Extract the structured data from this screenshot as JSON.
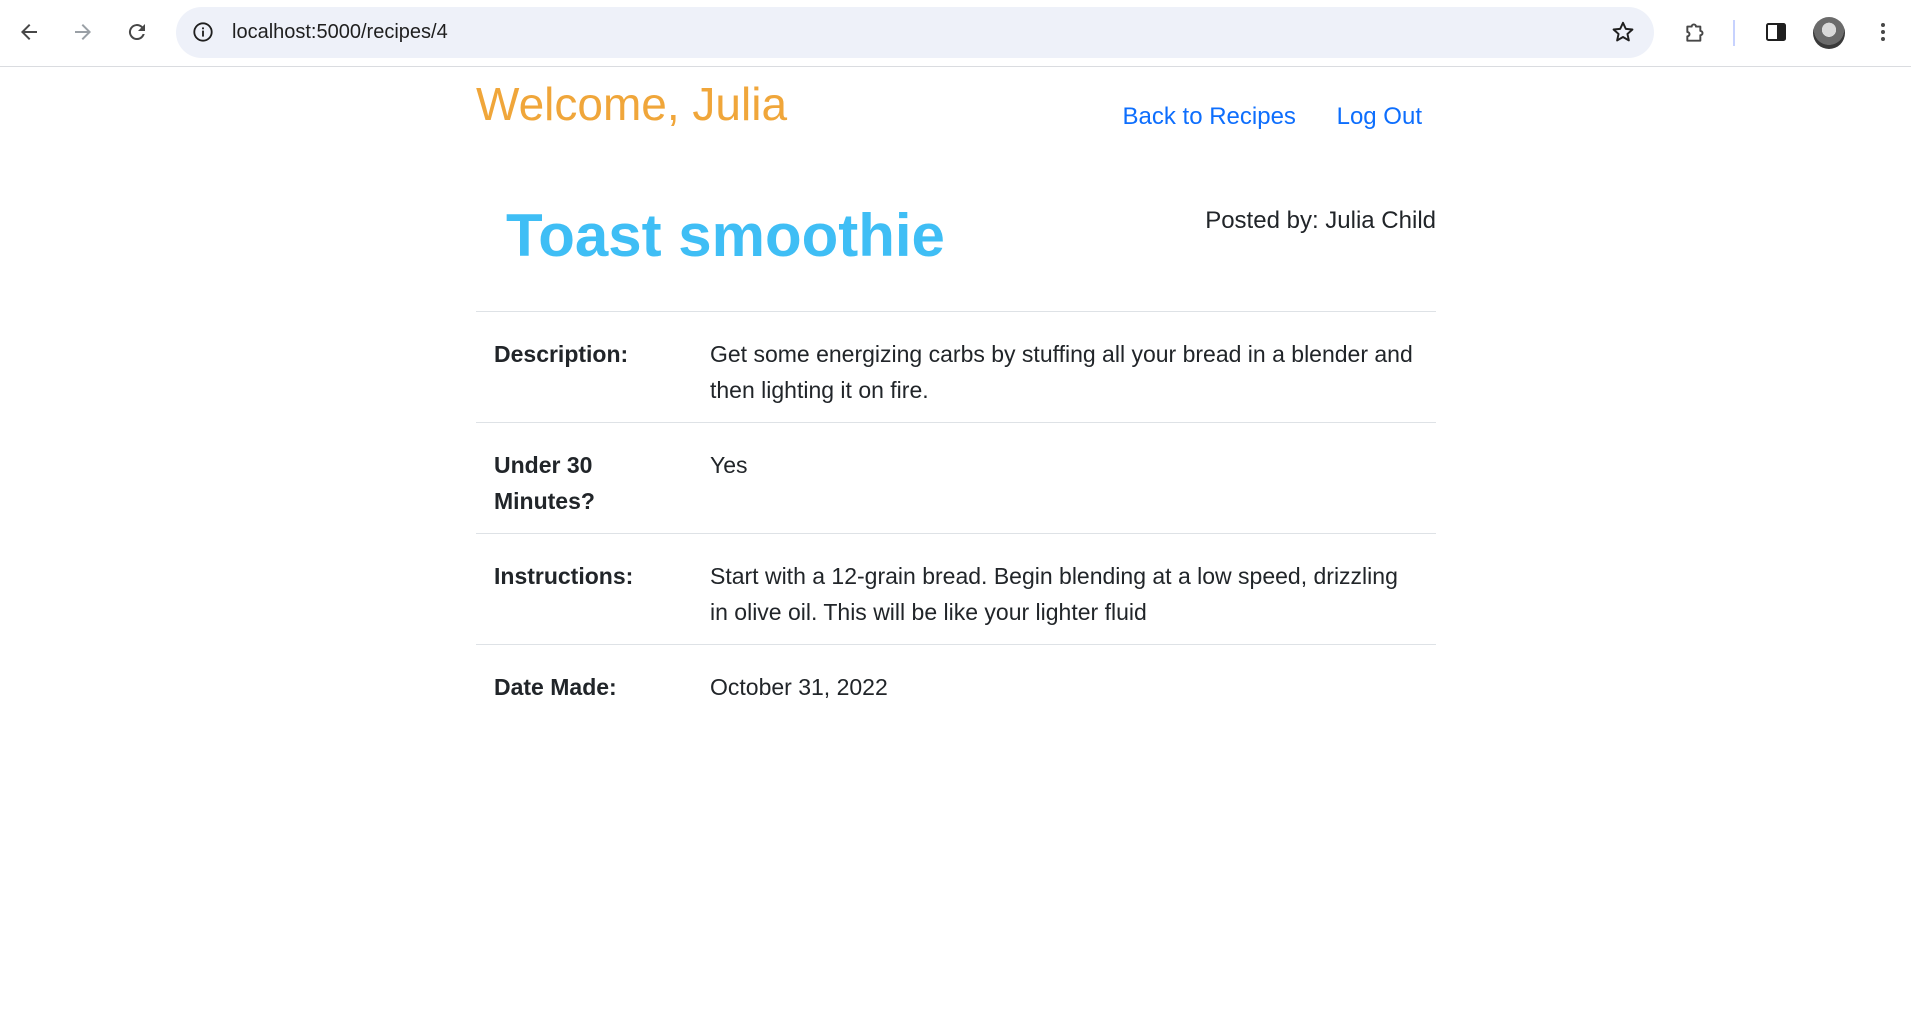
{
  "browser": {
    "url": "localhost:5000/recipes/4",
    "icons": {
      "back": "arrow-left-icon",
      "forward": "arrow-right-icon",
      "reload": "reload-icon",
      "info": "info-icon",
      "bookmark": "star-icon",
      "extensions": "puzzle-icon",
      "side_panel": "side-panel-icon",
      "profile": "avatar",
      "menu": "kebab-menu-icon"
    }
  },
  "header": {
    "welcome": "Welcome, Julia",
    "nav": {
      "back_to_recipes": "Back to Recipes",
      "log_out": "Log Out"
    }
  },
  "recipe": {
    "title": "Toast smoothie",
    "posted_by": "Posted by: Julia Child",
    "rows": [
      {
        "label": "Description:",
        "value": "Get some energizing carbs by stuffing all your bread in a blender and then lighting it on fire."
      },
      {
        "label": "Under 30 Minutes?",
        "value": "Yes"
      },
      {
        "label": "Instructions:",
        "value": "Start with a 12-grain bread. Begin blending at a low speed, drizzling in olive oil. This will be like your lighter fluid"
      },
      {
        "label": "Date Made:",
        "value": "October 31, 2022"
      }
    ]
  },
  "colors": {
    "welcome": "#f0a63a",
    "title": "#3fbef5",
    "link": "#0d6efd"
  }
}
